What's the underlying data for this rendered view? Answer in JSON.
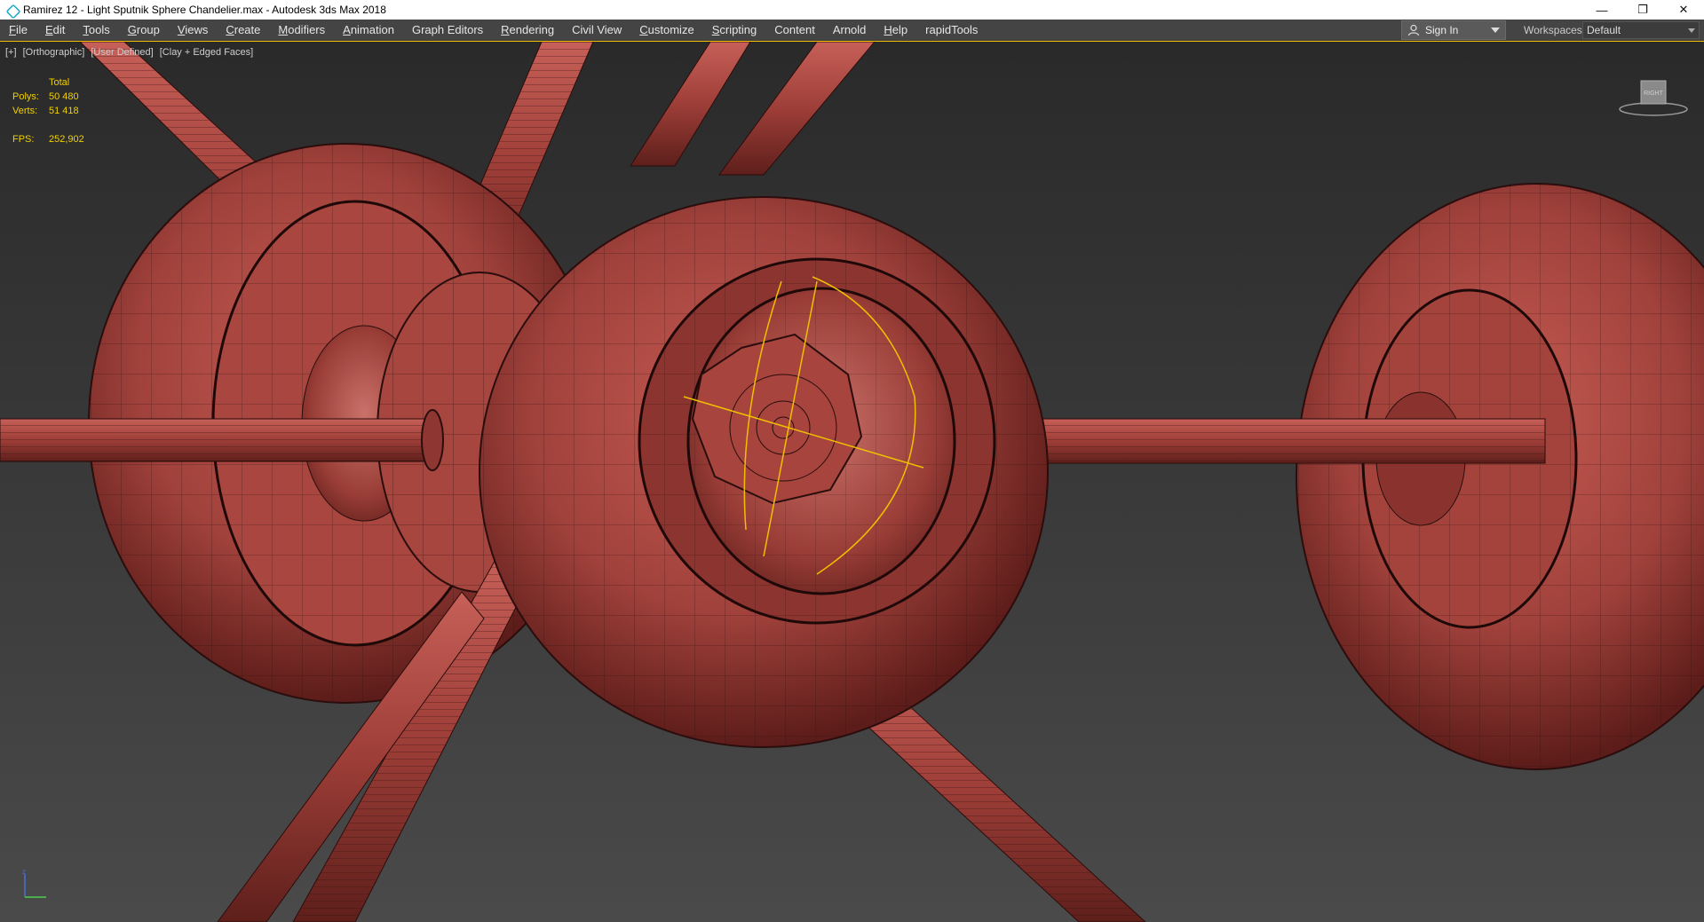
{
  "window": {
    "title": "Ramirez 12 - Light Sputnik Sphere Chandelier.max - Autodesk 3ds Max 2018",
    "controls": {
      "minimize": "—",
      "restore": "❐",
      "close": "✕"
    }
  },
  "menu": {
    "items": [
      {
        "label": "File",
        "u": "F",
        "rest": "ile"
      },
      {
        "label": "Edit",
        "u": "E",
        "rest": "dit"
      },
      {
        "label": "Tools",
        "u": "T",
        "rest": "ools"
      },
      {
        "label": "Group",
        "u": "G",
        "rest": "roup"
      },
      {
        "label": "Views",
        "u": "V",
        "rest": "iews"
      },
      {
        "label": "Create",
        "u": "C",
        "rest": "reate"
      },
      {
        "label": "Modifiers",
        "u": "M",
        "rest": "odifiers"
      },
      {
        "label": "Animation",
        "u": "A",
        "rest": "nimation"
      },
      {
        "label": "Graph Editors",
        "u": "",
        "rest": "Graph Editors"
      },
      {
        "label": "Rendering",
        "u": "R",
        "rest": "endering"
      },
      {
        "label": "Civil View",
        "u": "",
        "rest": "Civil View"
      },
      {
        "label": "Customize",
        "u": "C",
        "rest": "ustomize"
      },
      {
        "label": "Scripting",
        "u": "S",
        "rest": "cripting"
      },
      {
        "label": "Content",
        "u": "",
        "rest": "Content"
      },
      {
        "label": "Arnold",
        "u": "",
        "rest": "Arnold"
      },
      {
        "label": "Help",
        "u": "H",
        "rest": "elp"
      },
      {
        "label": "rapidTools",
        "u": "",
        "rest": "rapidTools"
      }
    ],
    "sign_in": "Sign In",
    "workspaces_label": "Workspaces:",
    "workspace_value": "Default"
  },
  "viewport": {
    "label": {
      "plus": "[+]",
      "view": "[Orthographic]",
      "pov": "[User Defined]",
      "shading": "[Clay + Edged Faces]"
    },
    "stats": {
      "total_label": "Total",
      "polys_label": "Polys:",
      "polys_value": "50 480",
      "verts_label": "Verts:",
      "verts_value": "51 418",
      "fps_label": "FPS:",
      "fps_value": "252,902"
    },
    "viewcube_face": "RIGHT"
  },
  "colors": {
    "clay": "#b14e47",
    "clay_dark": "#6e2622",
    "selection": "#f0c000",
    "menubar": "#444444"
  }
}
